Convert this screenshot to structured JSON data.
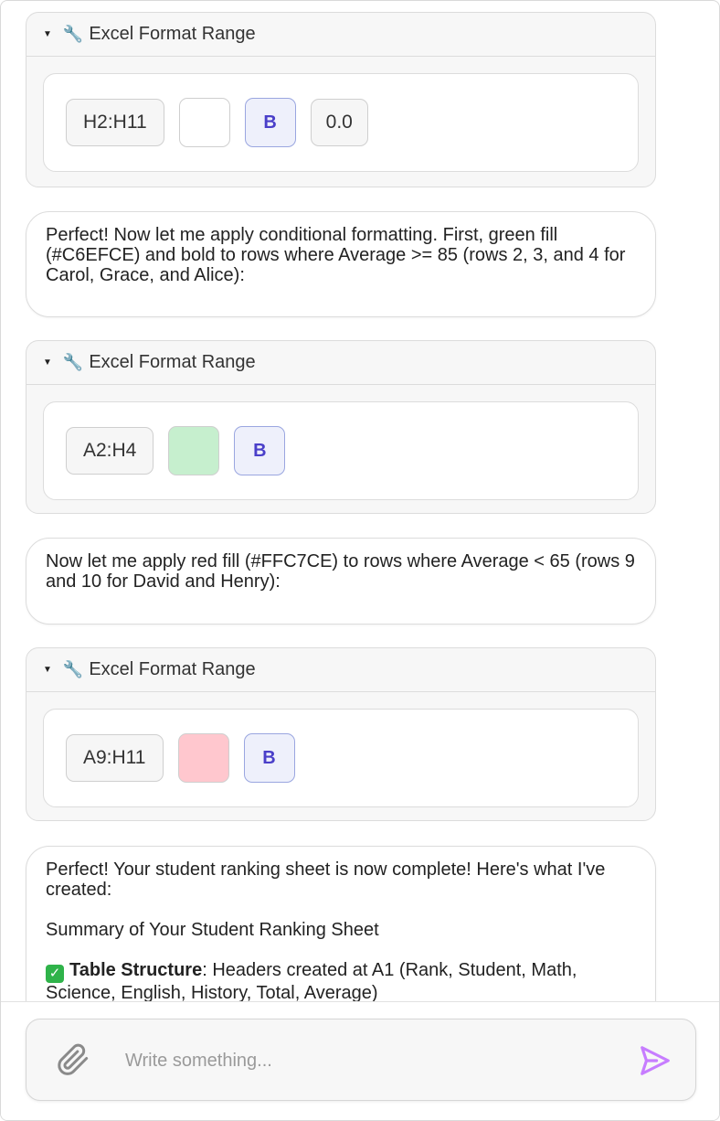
{
  "tool_cards": [
    {
      "title": "Excel Format Range",
      "range": "H2:H11",
      "fill_color": "#ffffff",
      "bold_label": "B",
      "number_format": "0.0"
    },
    {
      "title": "Excel Format Range",
      "range": "A2:H4",
      "fill_color": "#C6EFCE",
      "bold_label": "B"
    },
    {
      "title": "Excel Format Range",
      "range": "A9:H11",
      "fill_color": "#FFC7CE",
      "bold_label": "B"
    }
  ],
  "messages": {
    "m1": "Perfect! Now let me apply conditional formatting. First, green fill (#C6EFCE) and bold to rows where Average >= 85 (rows 2, 3, and 4 for Carol, Grace, and Alice):",
    "m2": "Now let me apply red fill (#FFC7CE) to rows where Average < 65 (rows 9 and 10 for David and Henry):",
    "m3_line1": "Perfect! Your student ranking sheet is now complete! Here's what I've created:",
    "m3_line2": "Summary of Your Student Ranking Sheet",
    "m3_bold": "Table Structure",
    "m3_rest": ": Headers created at A1 (Rank, Student, Math, Science, English, History, Total, Average)"
  },
  "composer": {
    "placeholder": "Write something...",
    "attach_icon": "paperclip-icon",
    "send_icon": "send-icon",
    "send_color": "#c77dff"
  }
}
